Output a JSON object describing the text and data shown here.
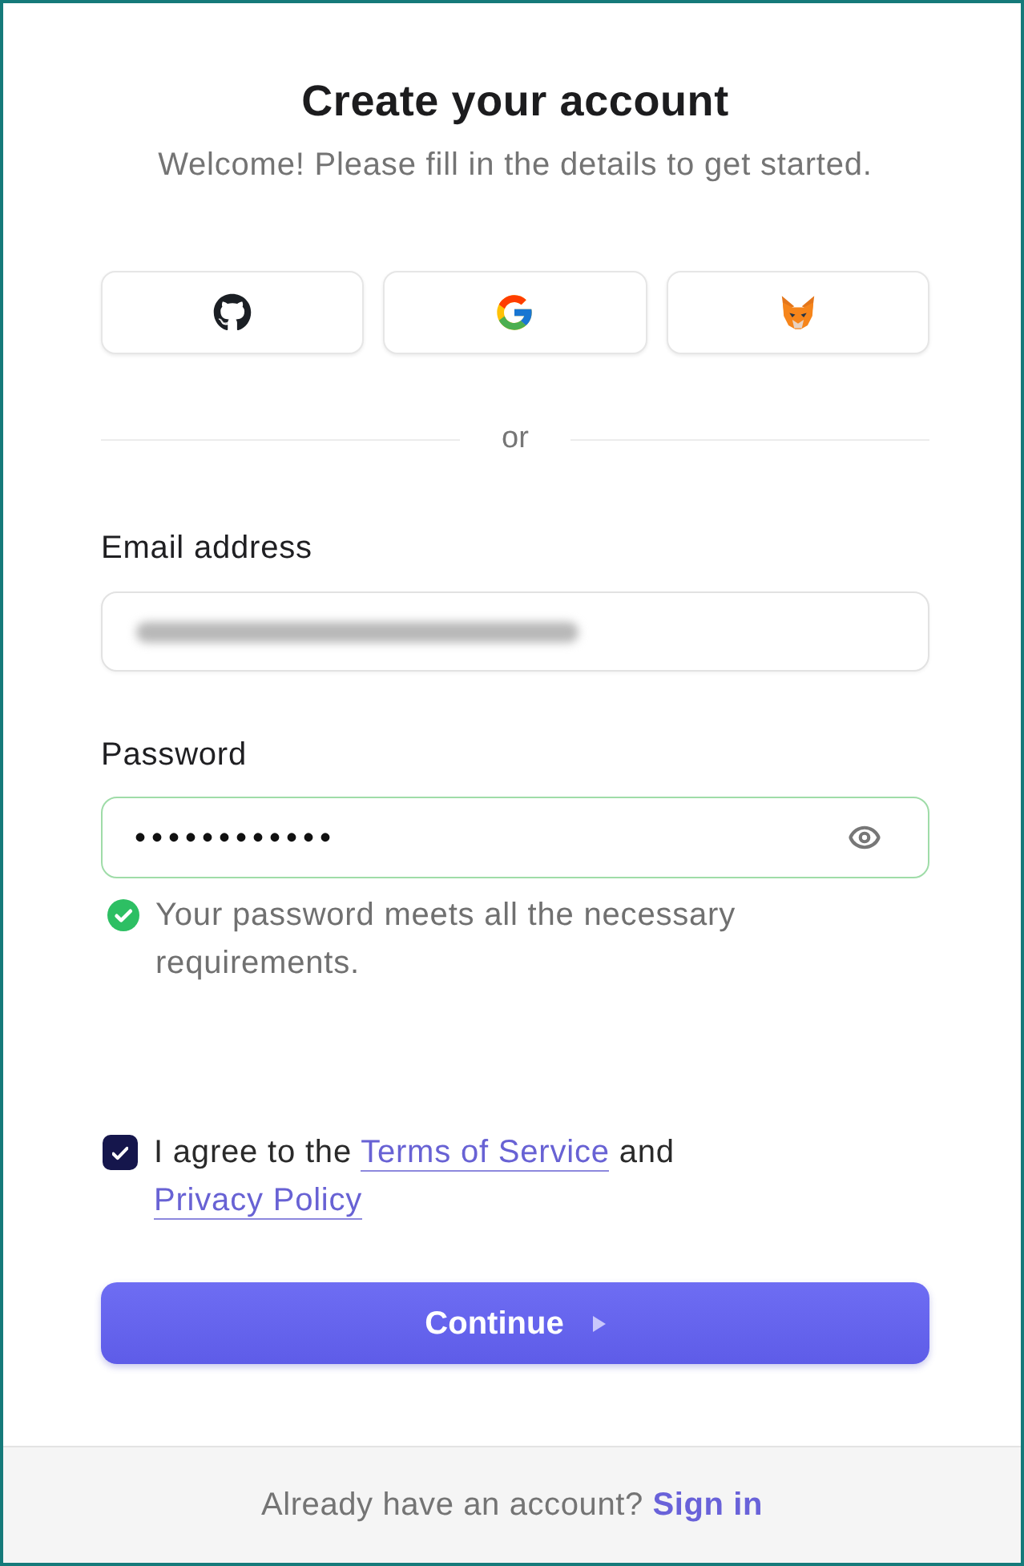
{
  "header": {
    "title": "Create your account",
    "subtitle": "Welcome! Please fill in the details to get started."
  },
  "social_buttons": [
    {
      "kind": "github"
    },
    {
      "kind": "google"
    },
    {
      "kind": "metamask"
    }
  ],
  "divider": {
    "label": "or"
  },
  "email": {
    "label": "Email address",
    "value_blurred": true
  },
  "password": {
    "label": "Password",
    "value": "••••••••••••",
    "valid": true,
    "message": "Your password meets all the necessary requirements."
  },
  "terms": {
    "checked": true,
    "text_before": "I agree to the",
    "links": [
      "Terms of Service",
      "Privacy Policy"
    ],
    "text_between": "and"
  },
  "submit": {
    "label": "Continue"
  },
  "footer": {
    "text": "Already have an account?",
    "link": "Sign in"
  }
}
